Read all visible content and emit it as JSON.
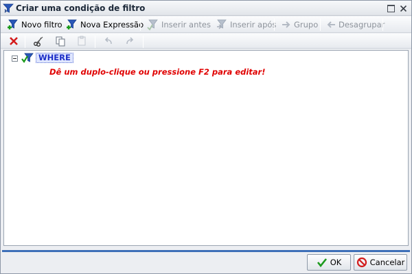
{
  "window": {
    "title": "Criar uma condição de filtro"
  },
  "toolbar": {
    "new_filter": "Novo filtro",
    "new_expression": "Nova Expressão",
    "insert_before": "Inserir antes",
    "insert_after": "Inserir após",
    "group": "Grupo",
    "ungroup": "Desagrupar"
  },
  "tree": {
    "root_label": "WHERE",
    "hint": "Dê um duplo-clique ou pressione F2 para editar!"
  },
  "footer": {
    "ok_label": "OK",
    "cancel_label": "Cancelar"
  },
  "colors": {
    "accent_blue": "#3d6fb8",
    "hint_red": "#e00000",
    "where_text": "#1d2fc8"
  }
}
